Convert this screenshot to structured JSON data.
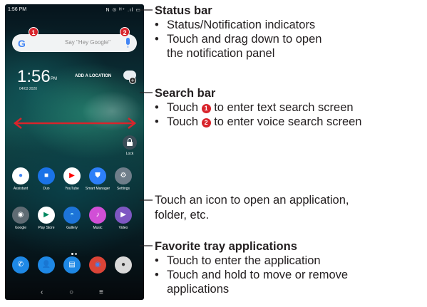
{
  "phone": {
    "status_time": "1:56 PM",
    "status_icons": "N ⊙ ᴴ⁺ .ıl ▭",
    "search": {
      "google_letter": "G",
      "hint": "Say \"Hey Google\""
    },
    "badges": [
      "1",
      "2"
    ],
    "clock": {
      "time": "1:56",
      "ampm": "PM",
      "date": "04/03 2020"
    },
    "add_location": "ADD A LOCATION",
    "weather_plus": "+",
    "lock_label": "Lock",
    "row1": [
      {
        "label": "Assistant",
        "color": "#ffffff",
        "glyph": "●",
        "glyph_color": "#4285f4"
      },
      {
        "label": "Duo",
        "color": "#1a73e8",
        "glyph": "■",
        "glyph_color": "#ffffff"
      },
      {
        "label": "YouTube",
        "color": "#ffffff",
        "glyph": "▶",
        "glyph_color": "#ff0000",
        "inner": "#ff0000"
      },
      {
        "label": "Smart Manager",
        "color": "#2d7ff9",
        "glyph": "⛊",
        "glyph_color": "#ffffff"
      },
      {
        "label": "Settings",
        "color": "#6f7e8a",
        "glyph": "⚙",
        "glyph_color": "#ffffff"
      }
    ],
    "row2": [
      {
        "label": "Google",
        "color": "#5f6b73",
        "glyph": "◉",
        "glyph_color": "#ffffff"
      },
      {
        "label": "Play Store",
        "color": "#ffffff",
        "glyph": "▶",
        "glyph_color": "#01875f"
      },
      {
        "label": "Gallery",
        "color": "#1d74d8",
        "glyph": "◓",
        "glyph_color": "#8fe0ff"
      },
      {
        "label": "Music",
        "color": "#d14fd6",
        "glyph": "♪",
        "glyph_color": "#ffffff"
      },
      {
        "label": "Video",
        "color": "#7e57c2",
        "glyph": "▶",
        "glyph_color": "#ffffff"
      }
    ],
    "tray": [
      {
        "name": "phone",
        "color": "#1e88e5",
        "glyph": "✆",
        "glyph_color": "#ffffff"
      },
      {
        "name": "contacts",
        "color": "#1e88e5",
        "glyph": "👤",
        "glyph_color": "#ffffff"
      },
      {
        "name": "messages",
        "color": "#1e88e5",
        "glyph": "▤",
        "glyph_color": "#ffffff"
      },
      {
        "name": "chrome",
        "color": "#db4437",
        "glyph": "◉",
        "glyph_color": "#4285f4"
      },
      {
        "name": "camera",
        "color": "#d9d9d9",
        "glyph": "●",
        "glyph_color": "#333333"
      }
    ],
    "nav": {
      "back": "‹",
      "home": "○",
      "recents": "≡"
    }
  },
  "callouts": {
    "status_bar": {
      "heading": "Status bar",
      "bullets": [
        "Status/Notification indicators",
        "Touch and drag down to open"
      ],
      "continuation": "the notification panel"
    },
    "search_bar": {
      "heading": "Search bar",
      "bullet1_pre": "Touch ",
      "bullet1_badge": "1",
      "bullet1_post": " to enter text search screen",
      "bullet2_pre": "Touch ",
      "bullet2_badge": "2",
      "bullet2_post": " to enter voice search screen"
    },
    "icons": {
      "line1": "Touch an icon to open an application,",
      "line2": "folder, etc."
    },
    "favorite": {
      "heading": "Favorite tray applications",
      "bullets": [
        "Touch to enter the application",
        "Touch and hold to move or remove"
      ],
      "continuation": "applications"
    }
  },
  "colors": {
    "accent_red": "#d8242b",
    "text": "#231f20"
  }
}
